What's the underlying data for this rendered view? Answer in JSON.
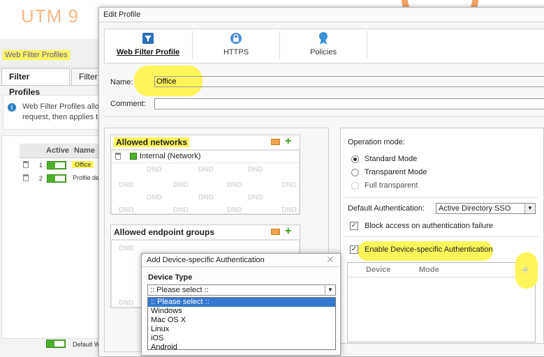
{
  "app": {
    "logo": "UTM 9",
    "breadcrumb": "Web Filter Profiles",
    "tabs": [
      "Filter Profiles",
      "Filter A"
    ],
    "info_text": [
      "Web Filter Profiles allow",
      "request, then applies th"
    ],
    "table": {
      "headers": [
        "Active",
        "Name"
      ],
      "rows": [
        {
          "num": "1",
          "name": "Office"
        },
        {
          "num": "2",
          "name": "Profile de"
        }
      ],
      "footer_label": "Default W"
    }
  },
  "dialog": {
    "title": "Edit Profile",
    "tabs": [
      {
        "label": "Web Filter Profile",
        "icon": "filter-icon",
        "active": true
      },
      {
        "label": "HTTPS",
        "icon": "lock-globe-icon",
        "active": false
      },
      {
        "label": "Policies",
        "icon": "ribbon-icon",
        "active": false
      }
    ],
    "name_label": "Name:",
    "name_value": "Office",
    "comment_label": "Comment:",
    "comment_value": "",
    "allowed_networks": {
      "title": "Allowed networks",
      "items": [
        "Internal (Network)"
      ],
      "dnd_text": "DND"
    },
    "allowed_endpoint_groups": {
      "title": "Allowed endpoint groups",
      "dnd_text": "DND"
    },
    "operation_mode": {
      "label": "Operation mode:",
      "options": [
        {
          "label": "Standard Mode",
          "checked": true,
          "disabled": false
        },
        {
          "label": "Transparent Mode",
          "checked": false,
          "disabled": false
        },
        {
          "label": "Full transparent",
          "checked": false,
          "disabled": true
        }
      ]
    },
    "default_auth": {
      "label": "Default Authentication:",
      "value": "Active Directory SSO"
    },
    "block_access": {
      "label": "Block access on authentication failure",
      "checked": true
    },
    "device_auth": {
      "label": "Enable Device-specific Authentication",
      "checked": true
    },
    "device_table": {
      "headers": [
        "Device",
        "Mode"
      ],
      "add_icon": "plus-icon"
    }
  },
  "popup": {
    "title": "Add Device-specific Authentication",
    "device_type_label": "Device Type",
    "select_value": ":: Please select ::",
    "options": [
      ":: Please select ::",
      "Windows",
      "Mac OS X",
      "Linux",
      "iOS",
      "Android"
    ]
  },
  "colors": {
    "highlight": "#fdf55a",
    "accent_green": "#4caf2a",
    "selection_blue": "#3478d0",
    "logo_orange": "#f6b98a"
  }
}
